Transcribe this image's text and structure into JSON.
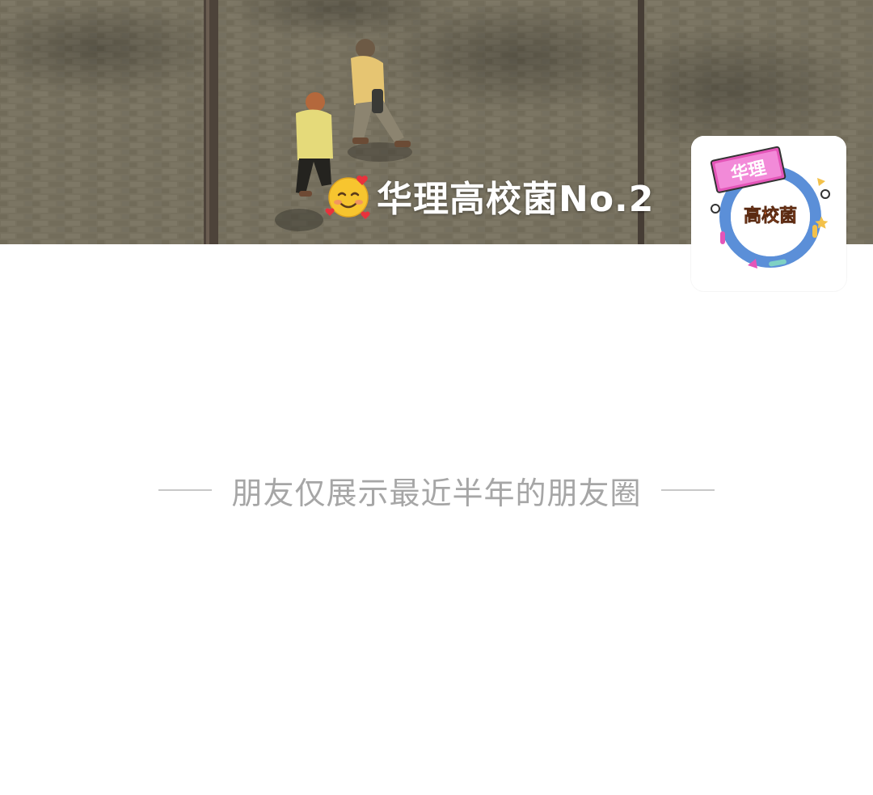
{
  "profile": {
    "nickname": "华理高校菌No.2",
    "nickname_emoji": "smiling-face-with-hearts-icon",
    "avatar": {
      "badge_top_text": "华理",
      "badge_center_text": "高校菌"
    }
  },
  "moments": {
    "notice": "朋友仅展示最近半年的朋友圈"
  },
  "colors": {
    "background": "#ffffff",
    "notice_text": "#a6a6a6",
    "divider": "#c8c8c8",
    "avatar_ring": "#5b8fd8",
    "avatar_label_pink": "#e455b8",
    "avatar_center_text": "#e0703a"
  }
}
